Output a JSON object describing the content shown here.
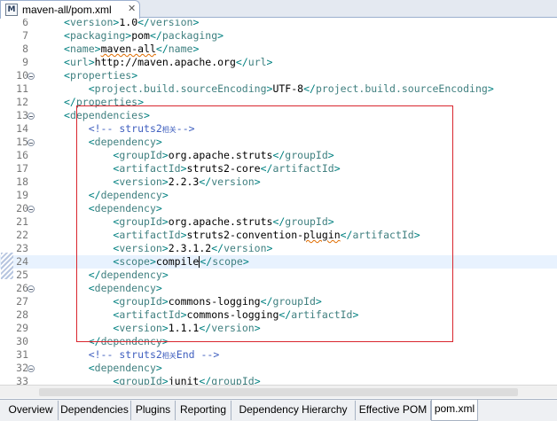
{
  "window": {
    "tab_title": "maven-all/pom.xml",
    "tab_icon_letter": "M",
    "close_glyph": "✕"
  },
  "editor": {
    "lines": [
      {
        "n": "6",
        "html": "<span class='bracket'>&lt;</span><span class='tag'>version</span><span class='bracket'>&gt;</span>1.0<span class='bracket'>&lt;/</span><span class='tag'>version</span><span class='bracket'>&gt;</span>",
        "fold": false
      },
      {
        "n": "7",
        "html": "<span class='bracket'>&lt;</span><span class='tag'>packaging</span><span class='bracket'>&gt;</span><span class='txt'>pom</span><span class='bracket'>&lt;/</span><span class='tag'>packaging</span><span class='bracket'>&gt;</span>",
        "fold": false
      },
      {
        "n": "8",
        "html": "<span class='bracket'>&lt;</span><span class='tag'>name</span><span class='bracket'>&gt;</span><span class='txt squiggle'>maven-all</span><span class='bracket'>&lt;/</span><span class='tag'>name</span><span class='bracket'>&gt;</span>",
        "fold": false
      },
      {
        "n": "9",
        "html": "<span class='bracket'>&lt;</span><span class='tag'>url</span><span class='bracket'>&gt;</span><span class='txt'>http://maven.apache.org</span><span class='bracket'>&lt;/</span><span class='tag'>url</span><span class='bracket'>&gt;</span>",
        "fold": false
      },
      {
        "n": "10",
        "html": "<span class='bracket'>&lt;</span><span class='tag'>properties</span><span class='bracket'>&gt;</span>",
        "fold": true
      },
      {
        "n": "11",
        "html": "    <span class='bracket'>&lt;</span><span class='tag'>project.build.sourceEncoding</span><span class='bracket'>&gt;</span><span class='txt'>UTF-8</span><span class='bracket'>&lt;/</span><span class='tag'>project.build.sourceEncoding</span><span class='bracket'>&gt;</span>",
        "fold": false
      },
      {
        "n": "12",
        "html": "<span class='bracket'>&lt;/</span><span class='tag'>properties</span><span class='bracket'>&gt;</span>",
        "fold": false
      },
      {
        "n": "13",
        "html": "<span class='bracket'>&lt;</span><span class='tag'>dependencies</span><span class='bracket'>&gt;</span>",
        "fold": true
      },
      {
        "n": "14",
        "html": "    <span class='cmt'>&lt;!-- struts2<span class='cmt-cjk'>相关</span>--&gt;</span>",
        "fold": false
      },
      {
        "n": "15",
        "html": "    <span class='bracket'>&lt;</span><span class='tag'>dependency</span><span class='bracket'>&gt;</span>",
        "fold": true
      },
      {
        "n": "16",
        "html": "        <span class='bracket'>&lt;</span><span class='tag'>groupId</span><span class='bracket'>&gt;</span><span class='txt'>org.apache.struts</span><span class='bracket'>&lt;/</span><span class='tag'>groupId</span><span class='bracket'>&gt;</span>",
        "fold": false
      },
      {
        "n": "17",
        "html": "        <span class='bracket'>&lt;</span><span class='tag'>artifactId</span><span class='bracket'>&gt;</span><span class='txt'>struts2-core</span><span class='bracket'>&lt;/</span><span class='tag'>artifactId</span><span class='bracket'>&gt;</span>",
        "fold": false
      },
      {
        "n": "18",
        "html": "        <span class='bracket'>&lt;</span><span class='tag'>version</span><span class='bracket'>&gt;</span><span class='txt'>2.2.3</span><span class='bracket'>&lt;/</span><span class='tag'>version</span><span class='bracket'>&gt;</span>",
        "fold": false
      },
      {
        "n": "19",
        "html": "    <span class='bracket'>&lt;/</span><span class='tag'>dependency</span><span class='bracket'>&gt;</span>",
        "fold": false
      },
      {
        "n": "20",
        "html": "    <span class='bracket'>&lt;</span><span class='tag'>dependency</span><span class='bracket'>&gt;</span>",
        "fold": true
      },
      {
        "n": "21",
        "html": "        <span class='bracket'>&lt;</span><span class='tag'>groupId</span><span class='bracket'>&gt;</span><span class='txt'>org.apache.struts</span><span class='bracket'>&lt;/</span><span class='tag'>groupId</span><span class='bracket'>&gt;</span>",
        "fold": false
      },
      {
        "n": "22",
        "html": "        <span class='bracket'>&lt;</span><span class='tag'>artifactId</span><span class='bracket'>&gt;</span><span class='txt'>struts2-convention-<span class='squiggle'>plugin</span></span><span class='bracket'>&lt;/</span><span class='tag'>artifactId</span><span class='bracket'>&gt;</span>",
        "fold": false
      },
      {
        "n": "23",
        "html": "        <span class='bracket'>&lt;</span><span class='tag'>version</span><span class='bracket'>&gt;</span><span class='txt'>2.3.1.2</span><span class='bracket'>&lt;/</span><span class='tag'>version</span><span class='bracket'>&gt;</span>",
        "fold": false
      },
      {
        "n": "24",
        "html": "        <span class='bracket'>&lt;</span><span class='tag'>scope</span><span class='bracket'>&gt;</span><span class='txt'>compile</span><span class='caret'></span><span class='bracket'>&lt;/</span><span class='tag'>scope</span><span class='bracket'>&gt;</span>",
        "fold": false,
        "current": true
      },
      {
        "n": "25",
        "html": "    <span class='bracket'>&lt;/</span><span class='tag'>dependency</span><span class='bracket'>&gt;</span>",
        "fold": false
      },
      {
        "n": "26",
        "html": "    <span class='bracket'>&lt;</span><span class='tag'>dependency</span><span class='bracket'>&gt;</span>",
        "fold": true
      },
      {
        "n": "27",
        "html": "        <span class='bracket'>&lt;</span><span class='tag'>groupId</span><span class='bracket'>&gt;</span><span class='txt'>commons-logging</span><span class='bracket'>&lt;/</span><span class='tag'>groupId</span><span class='bracket'>&gt;</span>",
        "fold": false
      },
      {
        "n": "28",
        "html": "        <span class='bracket'>&lt;</span><span class='tag'>artifactId</span><span class='bracket'>&gt;</span><span class='txt'>commons-logging</span><span class='bracket'>&lt;/</span><span class='tag'>artifactId</span><span class='bracket'>&gt;</span>",
        "fold": false
      },
      {
        "n": "29",
        "html": "        <span class='bracket'>&lt;</span><span class='tag'>version</span><span class='bracket'>&gt;</span><span class='txt'>1.1.1</span><span class='bracket'>&lt;/</span><span class='tag'>version</span><span class='bracket'>&gt;</span>",
        "fold": false
      },
      {
        "n": "30",
        "html": "    <span class='bracket'>&lt;/</span><span class='tag'>dependency</span><span class='bracket'>&gt;</span>",
        "fold": false
      },
      {
        "n": "31",
        "html": "    <span class='cmt'>&lt;!-- struts2<span class='cmt-cjk'>相关</span>End --&gt;</span>",
        "fold": false
      },
      {
        "n": "32",
        "html": "    <span class='bracket'>&lt;</span><span class='tag'>dependency</span><span class='bracket'>&gt;</span>",
        "fold": true
      },
      {
        "n": "33",
        "html": "        <span class='bracket'>&lt;</span><span class='tag'>groupId</span><span class='bracket'>&gt;</span><span class='txt squiggle'>junit</span><span class='bracket'>&lt;/</span><span class='tag'>groupId</span><span class='bracket'>&gt;</span>",
        "fold": false
      }
    ]
  },
  "page_tabs": [
    {
      "label": "Overview",
      "active": false
    },
    {
      "label": "Dependencies",
      "active": false
    },
    {
      "label": "Plugins",
      "active": false
    },
    {
      "label": "Reporting",
      "active": false
    },
    {
      "label": "Dependency Hierarchy",
      "active": false
    },
    {
      "label": "Effective POM",
      "active": false
    },
    {
      "label": "pom.xml",
      "active": true
    }
  ],
  "colors": {
    "highlight_border": "#d9262e",
    "current_line": "#e8f2fe",
    "tag": "#3f7f7f",
    "comment": "#3f5fbf"
  }
}
